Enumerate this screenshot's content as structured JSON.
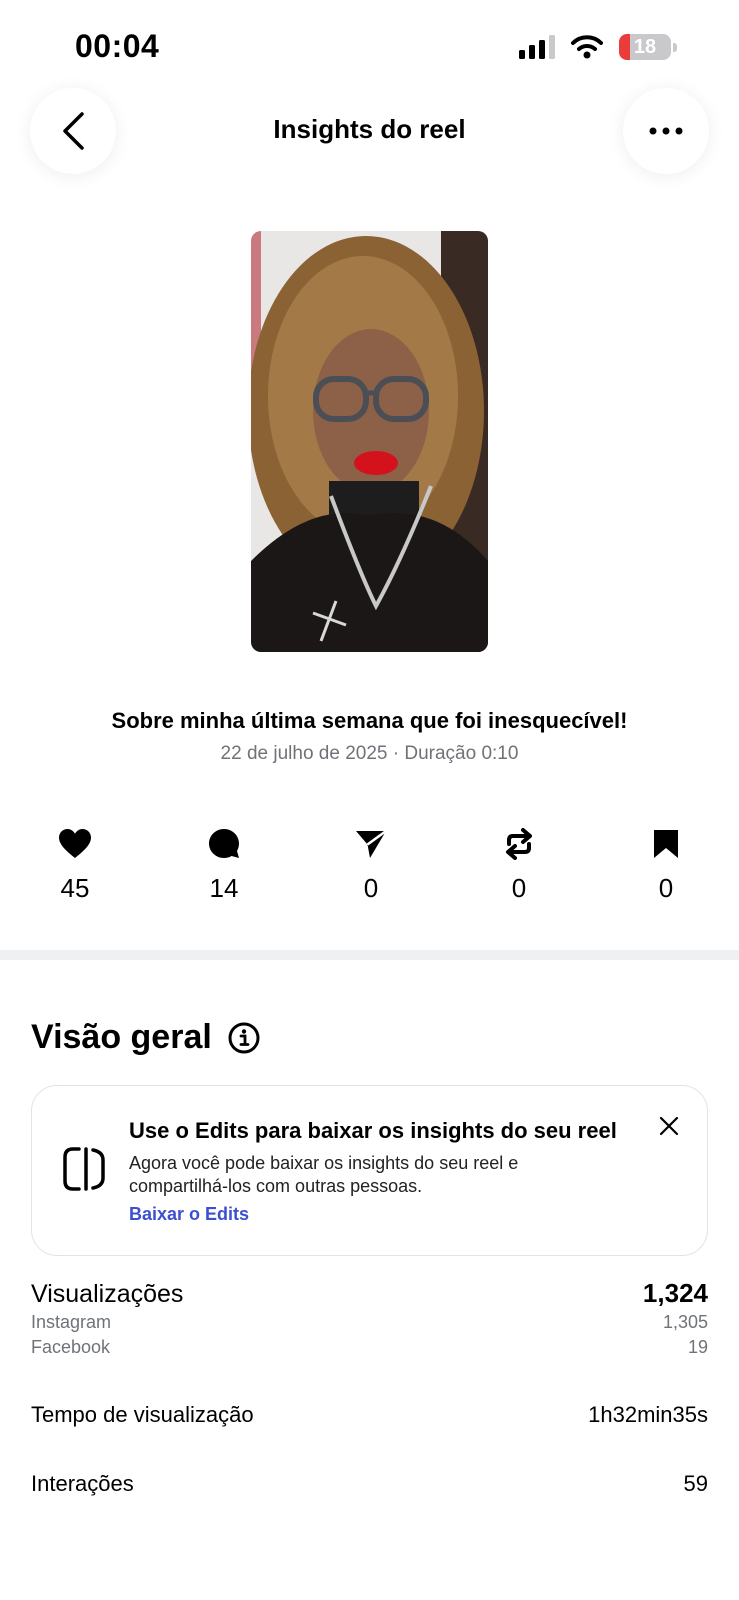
{
  "status": {
    "time": "00:04",
    "battery": "18"
  },
  "header": {
    "title": "Insights do reel"
  },
  "reel": {
    "title": "Sobre minha última semana que foi inesquecível!",
    "meta": "22 de julho de 2025 · Duração 0:10"
  },
  "stats": [
    {
      "icon": "heart-icon",
      "value": "45"
    },
    {
      "icon": "comment-icon",
      "value": "14"
    },
    {
      "icon": "share-icon",
      "value": "0"
    },
    {
      "icon": "repost-icon",
      "value": "0"
    },
    {
      "icon": "bookmark-icon",
      "value": "0"
    }
  ],
  "overview": {
    "title": "Visão geral",
    "promo": {
      "title": "Use o Edits para baixar os insights do seu reel",
      "body": "Agora você pode baixar os insights do seu reel e compartilhá-los com outras pessoas.",
      "link": "Baixar o Edits"
    },
    "views": {
      "label": "Visualizações",
      "value": "1,324",
      "instagram_label": "Instagram",
      "instagram_value": "1,305",
      "facebook_label": "Facebook",
      "facebook_value": "19"
    },
    "watch_time": {
      "label": "Tempo de visualização",
      "value": "1h32min35s"
    },
    "interactions": {
      "label": "Interações",
      "value": "59"
    }
  },
  "colors": {
    "link": "#3d4fd1",
    "muted": "#6f7378",
    "battery_low": "#eb3b3b"
  }
}
